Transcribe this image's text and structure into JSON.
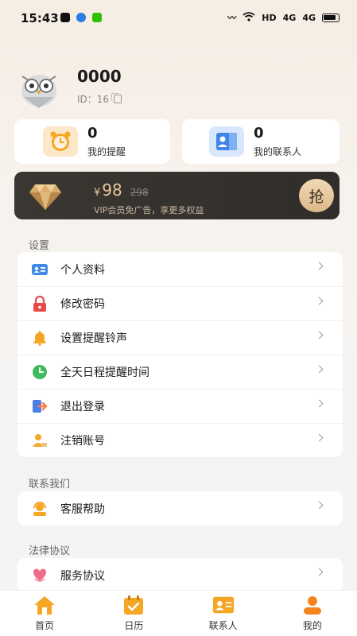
{
  "status_bar": {
    "time": "15:43",
    "network": "HD",
    "signal1": "4G",
    "signal2": "4G"
  },
  "profile": {
    "name": "0000",
    "id_text": "ID：16"
  },
  "stats": {
    "reminders": {
      "count": "0",
      "label": "我的提醒"
    },
    "contacts": {
      "count": "0",
      "label": "我的联系人"
    }
  },
  "vip": {
    "currency": "¥",
    "price": "98",
    "original_price": "298",
    "subtitle": "VIP会员免广告，享更多权益",
    "button_label": "抢"
  },
  "sections": {
    "settings": {
      "title": "设置",
      "items": [
        {
          "label": "个人资料",
          "icon": "id-card-icon"
        },
        {
          "label": "修改密码",
          "icon": "lock-icon"
        },
        {
          "label": "设置提醒铃声",
          "icon": "bell-icon"
        },
        {
          "label": "全天日程提醒时间",
          "icon": "clock-icon"
        },
        {
          "label": "退出登录",
          "icon": "logout-icon"
        },
        {
          "label": "注销账号",
          "icon": "user-remove-icon"
        }
      ]
    },
    "contact_us": {
      "title": "联系我们",
      "items": [
        {
          "label": "客服帮助",
          "icon": "support-icon"
        }
      ]
    },
    "legal": {
      "title": "法律协议",
      "items": [
        {
          "label": "服务协议",
          "icon": "agreement-icon"
        }
      ]
    }
  },
  "tabbar": {
    "home": "首页",
    "calendar": "日历",
    "contacts": "联系人",
    "mine": "我的"
  },
  "colors": {
    "accent_orange": "#f5a623",
    "vip_gold": "#e8c79b",
    "vip_bg": "#35322f"
  }
}
